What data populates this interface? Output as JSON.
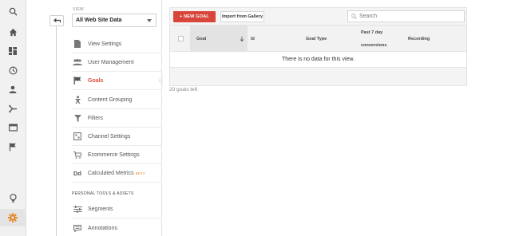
{
  "rail": {
    "icons": [
      "search-icon",
      "home-icon",
      "dashboard-icon",
      "clock-icon",
      "person-icon",
      "acquisition-icon",
      "behavior-icon",
      "flag-icon",
      "lightbulb-icon",
      "gear-icon"
    ]
  },
  "view": {
    "label": "VIEW",
    "selected": "All Web Site Data"
  },
  "nav": {
    "items": [
      {
        "label": "View Settings",
        "icon": "document-icon"
      },
      {
        "label": "User Management",
        "icon": "users-icon"
      },
      {
        "label": "Goals",
        "icon": "flag-icon",
        "active": true
      },
      {
        "label": "Content Grouping",
        "icon": "content-grouping-icon"
      },
      {
        "label": "Filters",
        "icon": "filter-icon"
      },
      {
        "label": "Channel Settings",
        "icon": "channel-icon"
      },
      {
        "label": "Ecommerce Settings",
        "icon": "cart-icon"
      },
      {
        "label": "Calculated Metrics",
        "icon": "dd-icon",
        "badge": "BETA"
      },
      {
        "label": "Segments",
        "icon": "segments-icon"
      },
      {
        "label": "Annotations",
        "icon": "annotations-icon"
      }
    ],
    "section_label": "PERSONAL TOOLS & ASSETS"
  },
  "toolbar": {
    "new_goal": "+ NEW GOAL",
    "import": "Import from Gallery",
    "search_placeholder": "Search"
  },
  "table": {
    "columns": [
      "Goal",
      "Id",
      "Goal Type",
      "Past 7 day",
      "conversions",
      "Recording"
    ],
    "empty_message": "There is no data for this view."
  },
  "goals_left": "20 goals left",
  "colors": {
    "accent": "#d8453a",
    "active_nav": "#e14b3b",
    "gear": "#e8882c"
  }
}
